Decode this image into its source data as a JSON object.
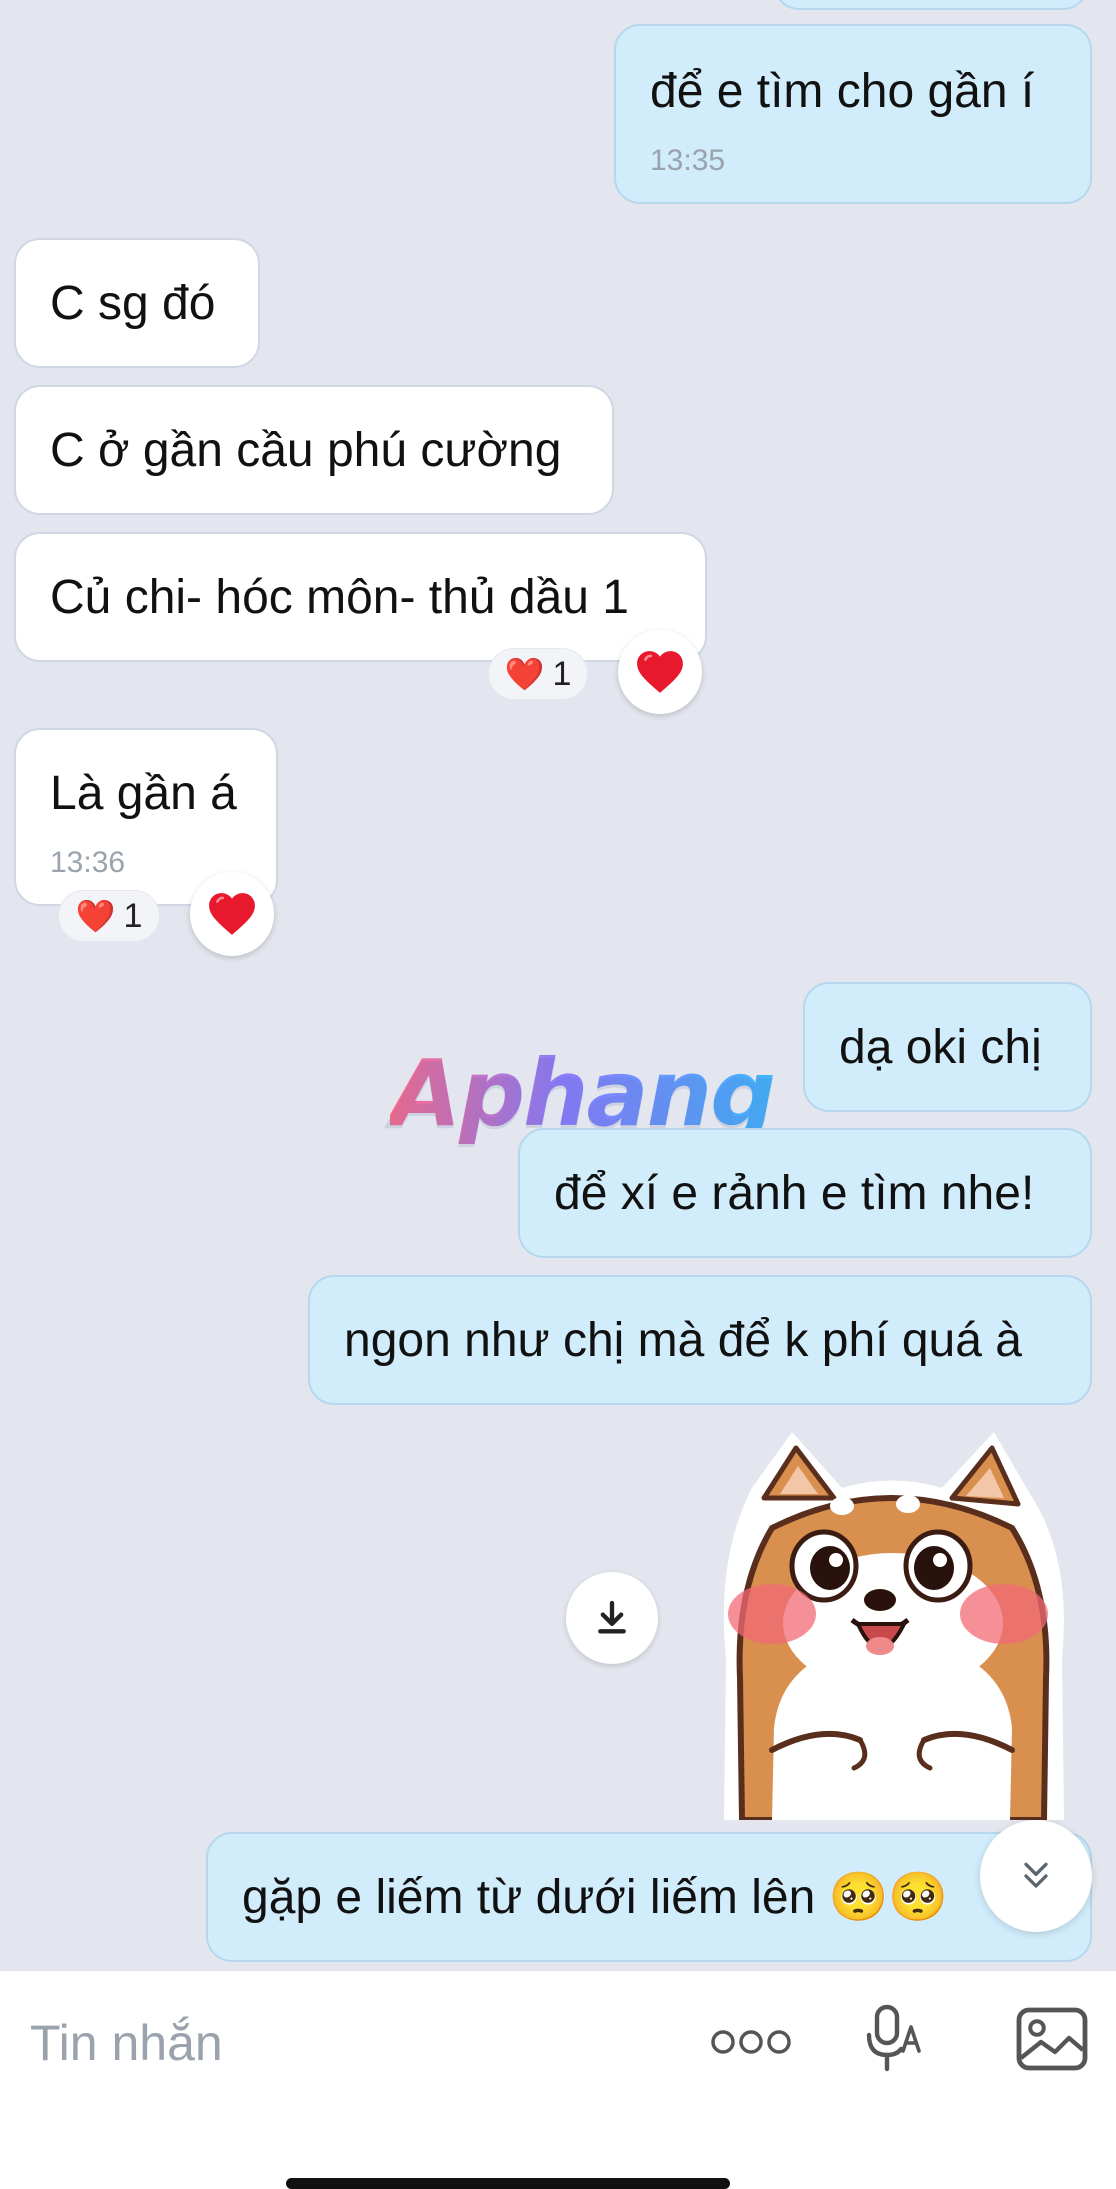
{
  "messages": [
    {
      "id": "m1",
      "side": "out",
      "text": "để e tìm cho gần í",
      "time": "13:35"
    },
    {
      "id": "m2",
      "side": "in",
      "text": "C sg đó"
    },
    {
      "id": "m3",
      "side": "in",
      "text": "C ở gần cầu phú cường"
    },
    {
      "id": "m4",
      "side": "in",
      "text": "Củ chi- hóc môn- thủ dầu 1",
      "reaction": {
        "emoji": "❤️",
        "count": "1"
      }
    },
    {
      "id": "m5",
      "side": "in",
      "text": "Là gần á",
      "time": "13:36",
      "reaction": {
        "emoji": "❤️",
        "count": "1"
      }
    },
    {
      "id": "m6",
      "side": "out",
      "text": "dạ oki chị"
    },
    {
      "id": "m7",
      "side": "out",
      "text": "để xí e rảnh e tìm nhe!"
    },
    {
      "id": "m8",
      "side": "out",
      "text": "ngon như chị mà để k phí quá à"
    },
    {
      "id": "m9",
      "side": "out",
      "type": "sticker",
      "sticker": "shiba-dog-blushing"
    },
    {
      "id": "m10",
      "side": "out",
      "text": "gặp e liếm từ dưới liếm lên 🥺🥺"
    }
  ],
  "watermark": "Aphang",
  "composer": {
    "placeholder": "Tin nhắn",
    "value": "",
    "icons": [
      "more-options-icon",
      "voice-to-text-icon",
      "image-icon"
    ]
  },
  "icons": {
    "reaction_button": "heart-icon",
    "download": "download-icon",
    "scroll_down": "double-chevron-down-icon"
  },
  "colors": {
    "background": "#e3e6ee",
    "incoming_bubble": "#ffffff",
    "outgoing_bubble": "#d1ecfb",
    "heart": "#e8192c"
  }
}
